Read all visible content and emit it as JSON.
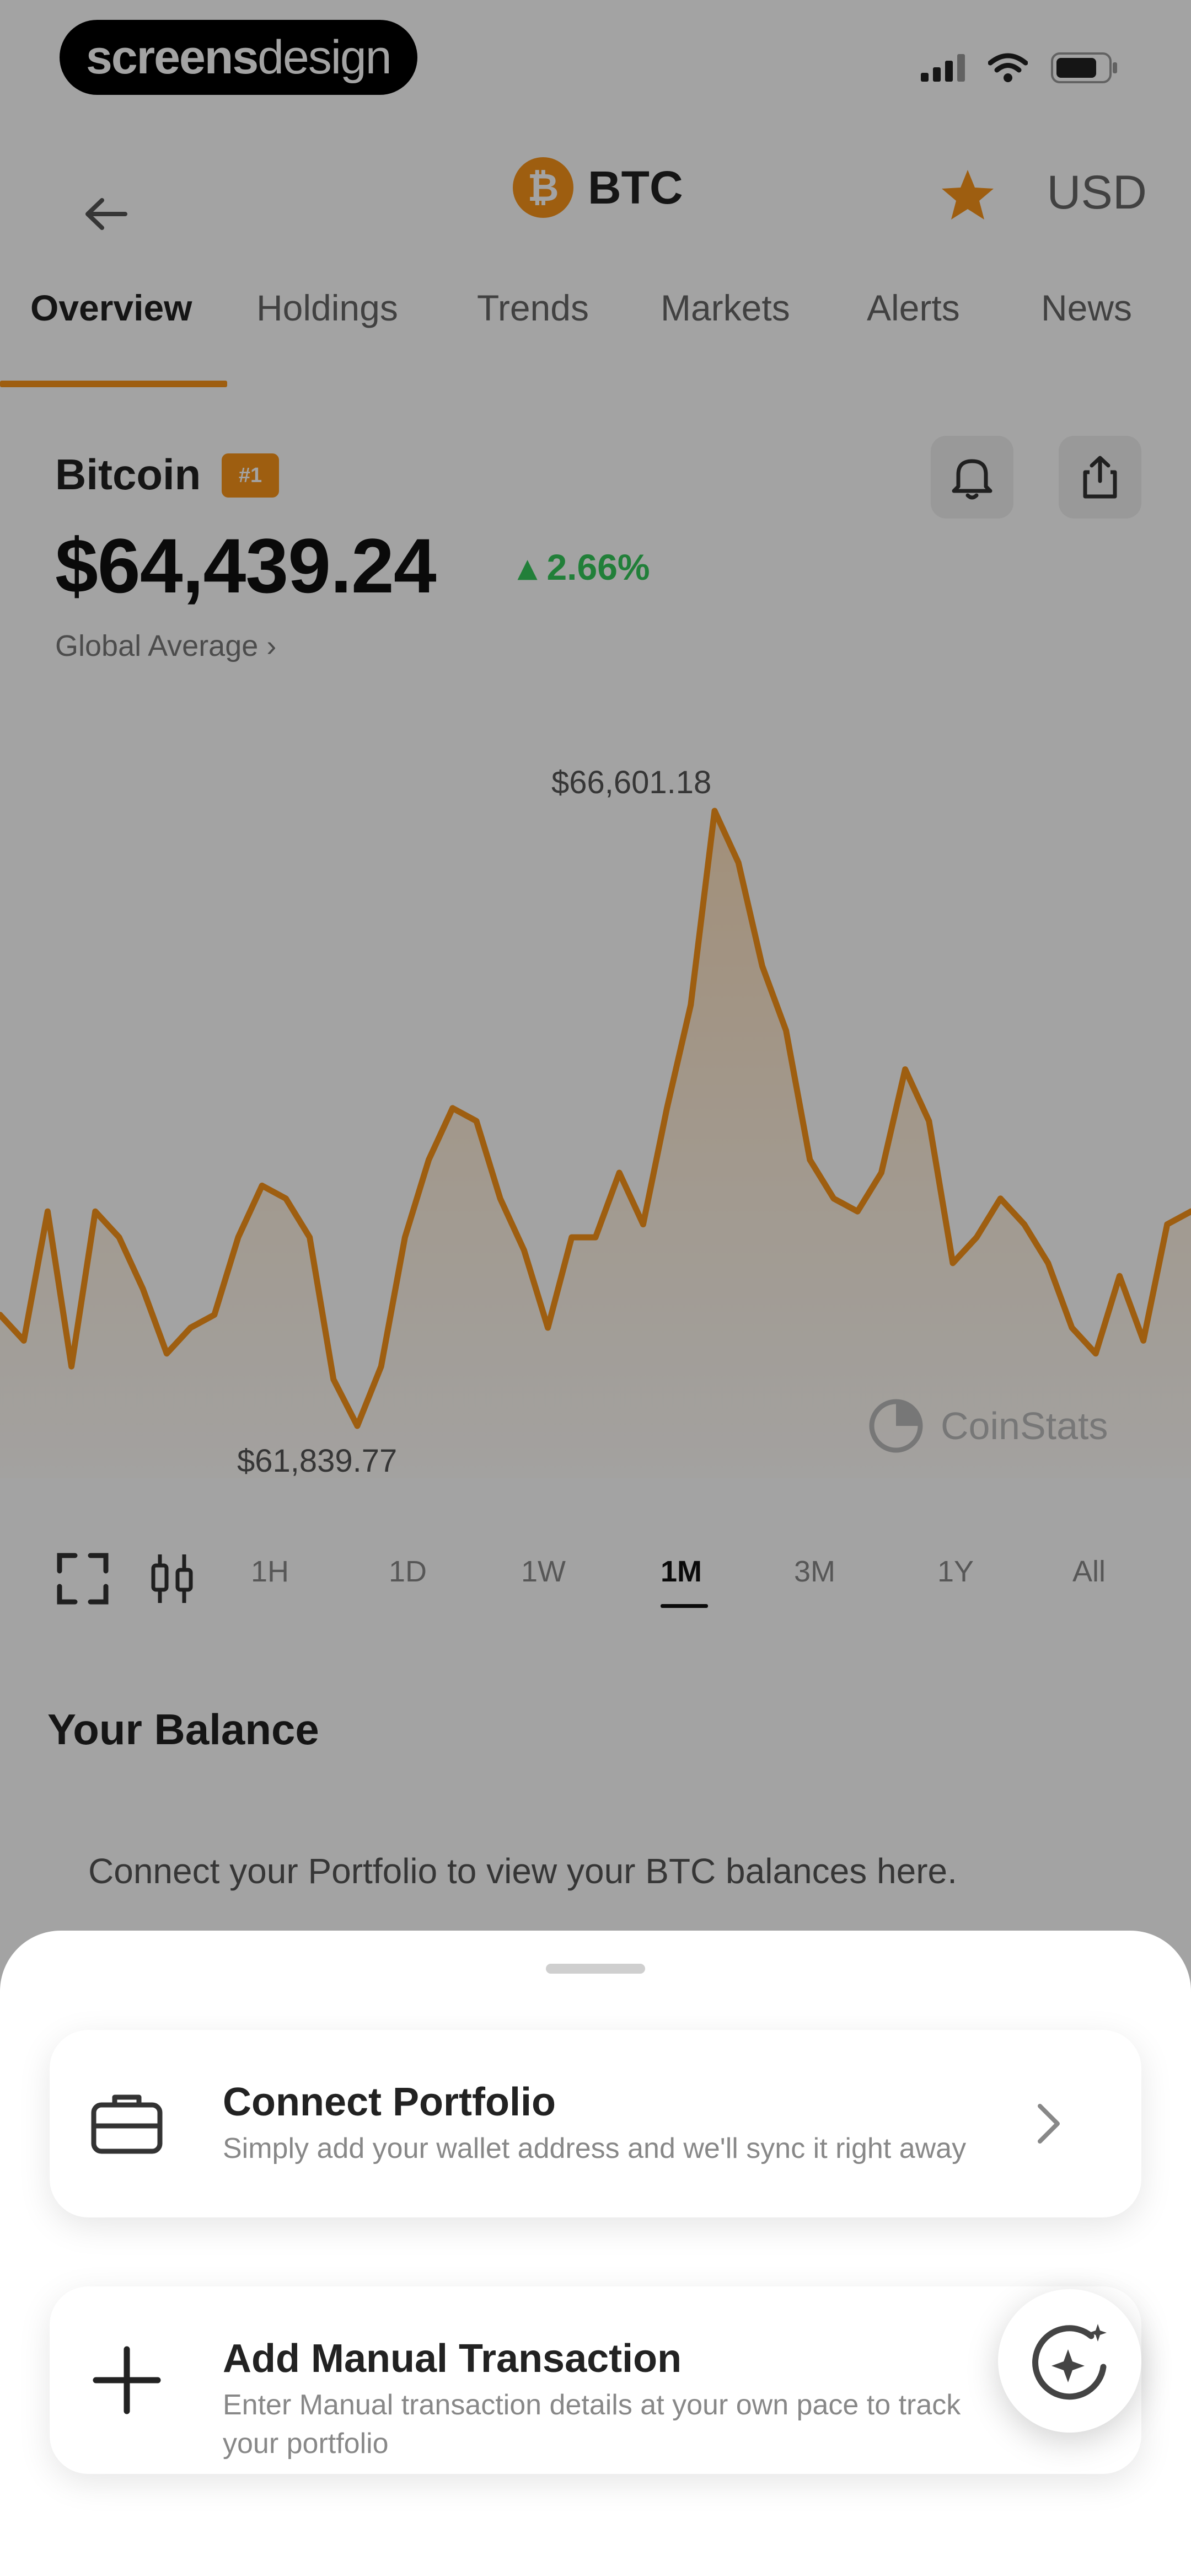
{
  "status_bar": {
    "brand_bold": "screens",
    "brand_light": "design"
  },
  "header": {
    "ticker": "BTC",
    "coin_symbol": "₿",
    "currency": "USD"
  },
  "tabs": [
    "Overview",
    "Holdings",
    "Trends",
    "Markets",
    "Alerts",
    "News"
  ],
  "coin": {
    "name": "Bitcoin",
    "rank_badge": "#1",
    "price": "$64,439.24",
    "change": "▴ 2.66%",
    "source": "Global Average ›"
  },
  "chart_data": {
    "type": "area",
    "max_label": "$66,601.18",
    "min_label": "$61,839.77",
    "y_range": [
      61839.77,
      66601.18
    ],
    "values": [
      62700,
      62500,
      63500,
      62300,
      63500,
      63300,
      62900,
      62400,
      62600,
      62700,
      63300,
      63700,
      63600,
      63300,
      62200,
      61839.77,
      62300,
      63300,
      63900,
      64300,
      64200,
      63600,
      63200,
      62600,
      63300,
      63300,
      63800,
      63400,
      64300,
      65100,
      66601.18,
      66200,
      65400,
      64900,
      63900,
      63600,
      63500,
      63800,
      64600,
      64200,
      63100,
      63300,
      63600,
      63400,
      63100,
      62600,
      62400,
      63000,
      62500,
      63400,
      63500
    ],
    "accent": "#f7931a"
  },
  "watermark": "CoinStats",
  "ranges": [
    "1H",
    "1D",
    "1W",
    "1M",
    "3M",
    "1Y",
    "All"
  ],
  "active_range": "1M",
  "balance": {
    "title": "Your Balance",
    "placeholder": "Connect your Portfolio to view your BTC balances here."
  },
  "sheet": {
    "items": [
      {
        "title": "Connect Portfolio",
        "desc": "Simply add your wallet address and we'll sync it right away"
      },
      {
        "title": "Add Manual Transaction",
        "desc": "Enter Manual transaction details at your own pace to track your portfolio"
      }
    ]
  }
}
